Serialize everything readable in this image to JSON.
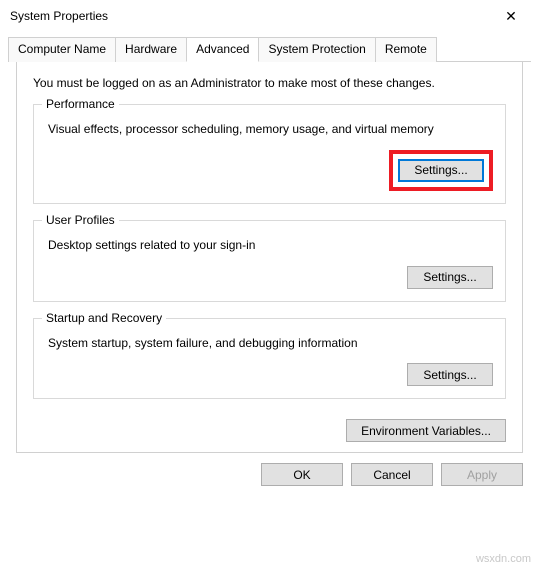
{
  "window": {
    "title": "System Properties",
    "close_glyph": "✕"
  },
  "tabs": {
    "computer_name": "Computer Name",
    "hardware": "Hardware",
    "advanced": "Advanced",
    "system_protection": "System Protection",
    "remote": "Remote"
  },
  "content": {
    "intro": "You must be logged on as an Administrator to make most of these changes.",
    "performance": {
      "title": "Performance",
      "desc": "Visual effects, processor scheduling, memory usage, and virtual memory",
      "button": "Settings..."
    },
    "user_profiles": {
      "title": "User Profiles",
      "desc": "Desktop settings related to your sign-in",
      "button": "Settings..."
    },
    "startup_recovery": {
      "title": "Startup and Recovery",
      "desc": "System startup, system failure, and debugging information",
      "button": "Settings..."
    },
    "env_button": "Environment Variables..."
  },
  "footer": {
    "ok": "OK",
    "cancel": "Cancel",
    "apply": "Apply"
  },
  "watermark": "wsxdn.com"
}
